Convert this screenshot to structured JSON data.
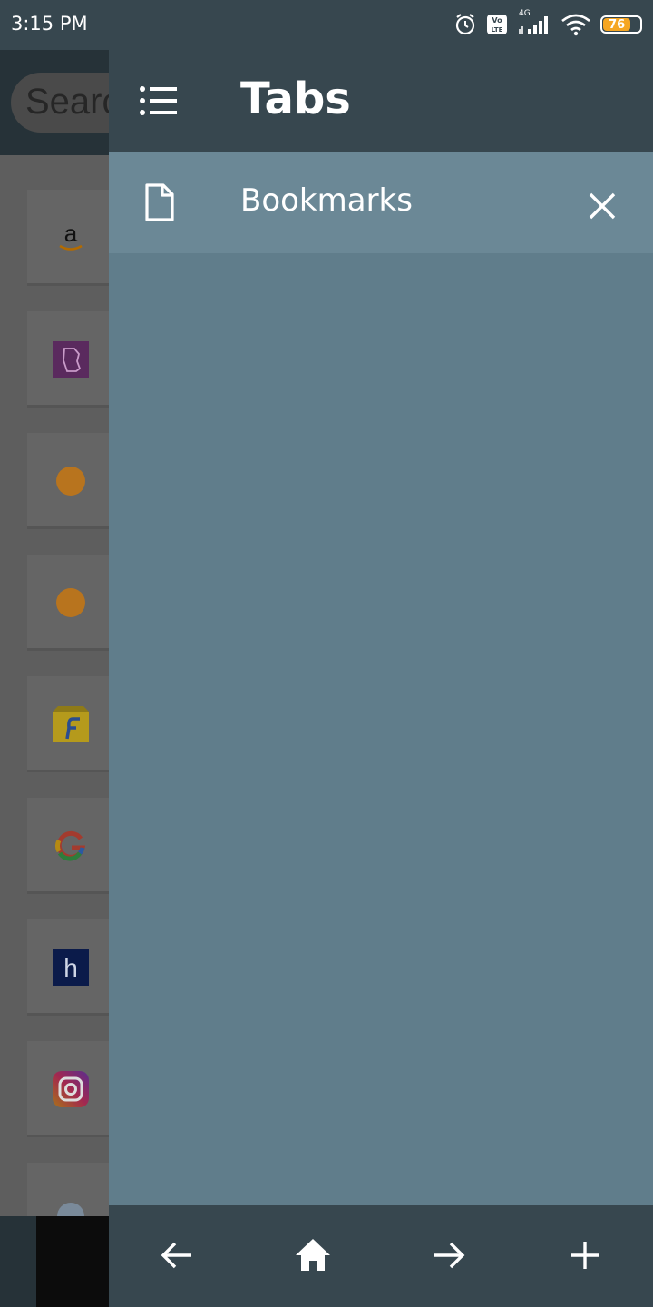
{
  "status_bar": {
    "time": "3:15 PM",
    "network": "4G",
    "volte": "Vo LTE",
    "battery": "76",
    "battery_level": 0.76
  },
  "background_app": {
    "search_placeholder": "Search",
    "shortcuts": [
      "amazon",
      "bewakoof",
      "orange-circle",
      "orange-circle",
      "flipkart",
      "google",
      "hotstar",
      "instagram",
      "globe"
    ]
  },
  "drawer": {
    "title": "Tabs",
    "tabs": [
      {
        "label": "Bookmarks"
      }
    ],
    "toolbar": [
      "back-icon",
      "home-icon",
      "forward-icon",
      "add-icon"
    ]
  },
  "colors": {
    "status_bar": "#37474f",
    "drawer_bg": "#607d8b",
    "tab_row": "#6b8896",
    "header": "#37474f",
    "battery": "#f5a623"
  }
}
